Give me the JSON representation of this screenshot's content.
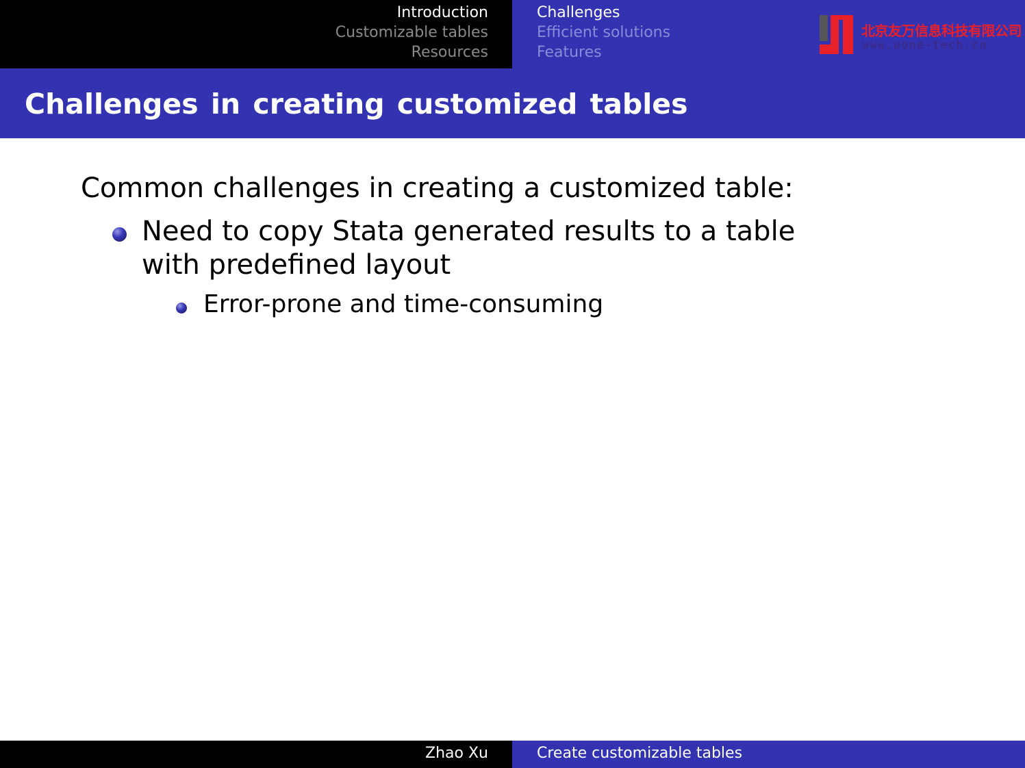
{
  "header": {
    "left_nav": [
      {
        "label": "Introduction",
        "active": true
      },
      {
        "label": "Customizable tables",
        "active": false
      },
      {
        "label": "Resources",
        "active": false
      }
    ],
    "right_nav": [
      {
        "label": "Challenges",
        "active": true
      },
      {
        "label": "Efficient solutions",
        "active": false
      },
      {
        "label": "Features",
        "active": false
      }
    ],
    "logo": {
      "company_cn": "北京友万信息科技有限公司",
      "url": "www.uone-tech.cn"
    }
  },
  "slide": {
    "title": "Challenges in creating customized tables",
    "intro": "Common challenges in creating a customized table:",
    "bullets": [
      {
        "text": "Need to copy Stata generated results to a table with predefined layout",
        "sub_bullets": [
          "Error-prone and time-consuming"
        ]
      }
    ]
  },
  "footer": {
    "author": "Zhao Xu",
    "presentation_title": "Create customizable tables"
  },
  "colors": {
    "beamer_blue": "#3333b2",
    "header_black": "#000000",
    "logo_red": "#e8202a",
    "logo_gray": "#555555"
  }
}
